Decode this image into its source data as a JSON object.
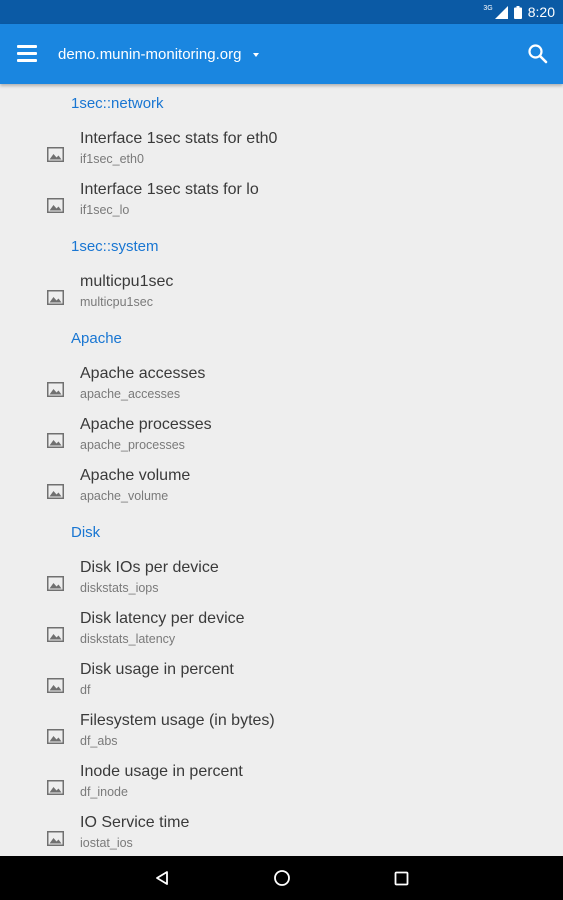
{
  "status_bar": {
    "network": "3G",
    "time": "8:20"
  },
  "app_bar": {
    "host": "demo.munin-monitoring.org"
  },
  "sections": [
    {
      "title": "1sec::network",
      "items": [
        {
          "title": "Interface 1sec stats for eth0",
          "subtitle": "if1sec_eth0"
        },
        {
          "title": "Interface 1sec stats for lo",
          "subtitle": "if1sec_lo"
        }
      ]
    },
    {
      "title": "1sec::system",
      "items": [
        {
          "title": "multicpu1sec",
          "subtitle": "multicpu1sec"
        }
      ]
    },
    {
      "title": "Apache",
      "items": [
        {
          "title": "Apache accesses",
          "subtitle": "apache_accesses"
        },
        {
          "title": "Apache processes",
          "subtitle": "apache_processes"
        },
        {
          "title": "Apache volume",
          "subtitle": "apache_volume"
        }
      ]
    },
    {
      "title": "Disk",
      "items": [
        {
          "title": "Disk IOs per device",
          "subtitle": "diskstats_iops"
        },
        {
          "title": "Disk latency per device",
          "subtitle": "diskstats_latency"
        },
        {
          "title": "Disk usage in percent",
          "subtitle": "df"
        },
        {
          "title": "Filesystem usage (in bytes)",
          "subtitle": "df_abs"
        },
        {
          "title": "Inode usage in percent",
          "subtitle": "df_inode"
        },
        {
          "title": "IO Service time",
          "subtitle": "iostat_ios"
        }
      ]
    }
  ],
  "colors": {
    "status_bar": "#0b5aa5",
    "app_bar": "#1a86e0",
    "section_header": "#1976d2",
    "background": "#eeeeee"
  }
}
